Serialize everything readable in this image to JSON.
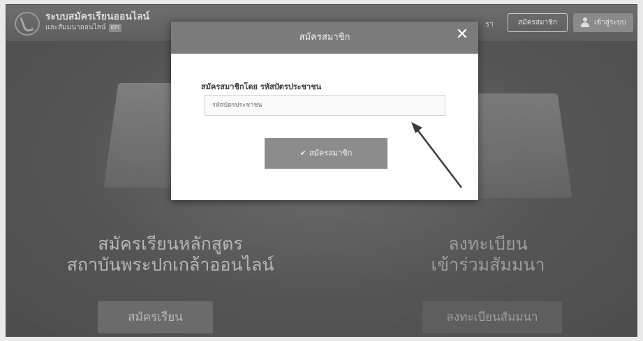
{
  "header": {
    "site_title": "ระบบสมัครเรียนออนไลน์",
    "site_subtitle": "และสัมมนาออนไลน์",
    "site_tag": "KPI",
    "nav_partial": "รา",
    "register_button": "สมัครสมาชิก",
    "login_button": "เข้าสู่ระบบ"
  },
  "hero": {
    "left_line1": "สมัครเรียนหลักสูตร",
    "left_line2": "สถาบันพระปกเกล้าออนไลน์",
    "right_line1": "ลงทะเบียน",
    "right_line2": "เข้าร่วมสัมมนา",
    "enroll_button": "สมัครเรียน",
    "seminar_button": "ลงทะเบียนสัมมนา"
  },
  "modal": {
    "title": "สมัครสมาชิก",
    "close_glyph": "✕",
    "field_label": "สมัครสมาชิกโดย รหัสบัตรประชาชน",
    "input_placeholder": "รหัสบัตรประชาชน",
    "input_value": "",
    "submit_check": "✔",
    "submit_label": "สมัครสมาชิก"
  },
  "icons": [
    "logo-icon",
    "user-icon",
    "close-icon",
    "check-icon"
  ],
  "colors": {
    "overlay_bg": "#5c5c5c",
    "modal_header": "#7b7b7b",
    "submit_button": "#8c8c8c"
  }
}
